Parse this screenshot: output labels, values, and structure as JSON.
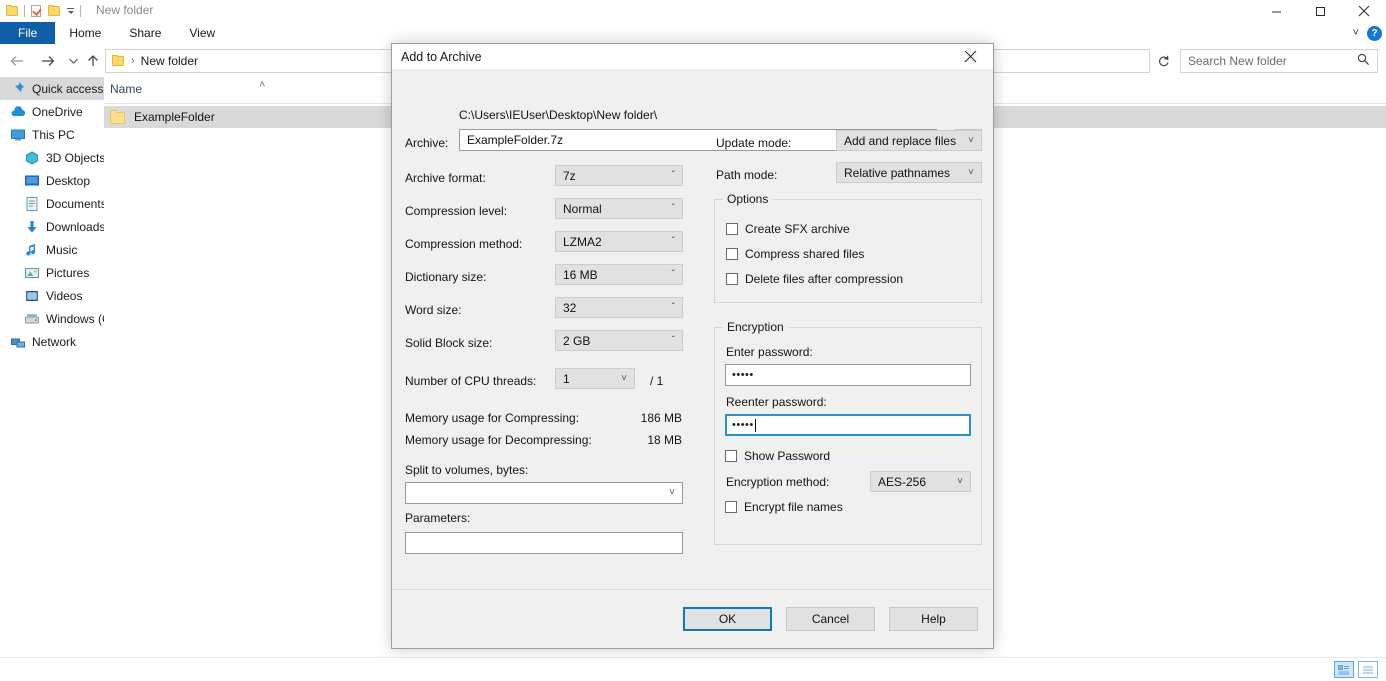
{
  "explorer": {
    "window_title": "New folder",
    "quick_access_toolbar": [
      "folder-icon",
      "properties-icon",
      "new-folder-icon",
      "customize-caret-icon"
    ],
    "ribbon_tabs": [
      {
        "label": "File",
        "active": true
      },
      {
        "label": "Home",
        "active": false
      },
      {
        "label": "Share",
        "active": false
      },
      {
        "label": "View",
        "active": false
      }
    ],
    "window_controls": {
      "minimize": "minimize-icon",
      "maximize": "maximize-icon",
      "close": "close-icon"
    },
    "ribbon_help": "?",
    "breadcrumb": {
      "root_icon": "folder-icon",
      "separator": "›",
      "path": "New folder"
    },
    "search": {
      "placeholder": "Search New folder",
      "value": ""
    },
    "sidebar": [
      {
        "label": "Quick access",
        "icon": "pin-icon",
        "selected": true,
        "indent": false
      },
      {
        "label": "OneDrive",
        "icon": "cloud-icon",
        "selected": false,
        "indent": false
      },
      {
        "label": "This PC",
        "icon": "monitor-icon",
        "selected": false,
        "indent": false
      },
      {
        "label": "3D Objects",
        "icon": "cube-icon",
        "selected": false,
        "indent": true
      },
      {
        "label": "Desktop",
        "icon": "desktop-icon",
        "selected": false,
        "indent": true
      },
      {
        "label": "Documents",
        "icon": "document-icon",
        "selected": false,
        "indent": true
      },
      {
        "label": "Downloads",
        "icon": "download-icon",
        "selected": false,
        "indent": true
      },
      {
        "label": "Music",
        "icon": "music-note-icon",
        "selected": false,
        "indent": true
      },
      {
        "label": "Pictures",
        "icon": "picture-icon",
        "selected": false,
        "indent": true
      },
      {
        "label": "Videos",
        "icon": "video-icon",
        "selected": false,
        "indent": true
      },
      {
        "label": "Windows (C:)",
        "icon": "drive-icon",
        "selected": false,
        "indent": true
      },
      {
        "label": "Network",
        "icon": "network-icon",
        "selected": false,
        "indent": false
      }
    ],
    "list": {
      "column_header": "Name",
      "sort_caret": "˄",
      "rows": [
        {
          "name": "ExampleFolder",
          "icon": "folder-icon",
          "selected": true
        }
      ]
    },
    "statusbar": {
      "text": "",
      "view_buttons": [
        "details-view-icon",
        "large-icons-view-icon"
      ]
    }
  },
  "dialog": {
    "title": "Add to Archive",
    "close_icon": "close-icon",
    "archive": {
      "label": "Archive:",
      "path": "C:\\Users\\IEUser\\Desktop\\New folder\\",
      "value": "ExampleFolder.7z",
      "browse_label": "..."
    },
    "left_fields": [
      {
        "label": "Archive format:",
        "value": "7z"
      },
      {
        "label": "Compression level:",
        "value": "Normal"
      },
      {
        "label": "Compression method:",
        "value": "LZMA2"
      },
      {
        "label": "Dictionary size:",
        "value": "16 MB"
      },
      {
        "label": "Word size:",
        "value": "32"
      },
      {
        "label": "Solid Block size:",
        "value": "2 GB"
      }
    ],
    "cpu_threads": {
      "label": "Number of CPU threads:",
      "value": "1",
      "total": "/ 1"
    },
    "memory": [
      {
        "label": "Memory usage for Compressing:",
        "value": "186 MB"
      },
      {
        "label": "Memory usage for Decompressing:",
        "value": "18 MB"
      }
    ],
    "split_volumes": {
      "label": "Split to volumes, bytes:",
      "value": ""
    },
    "parameters": {
      "label": "Parameters:",
      "value": ""
    },
    "right_fields": [
      {
        "label": "Update mode:",
        "value": "Add and replace files"
      },
      {
        "label": "Path mode:",
        "value": "Relative pathnames"
      }
    ],
    "options": {
      "legend": "Options",
      "items": [
        {
          "label": "Create SFX archive",
          "checked": false
        },
        {
          "label": "Compress shared files",
          "checked": false
        },
        {
          "label": "Delete files after compression",
          "checked": false
        }
      ]
    },
    "encryption": {
      "legend": "Encryption",
      "enter_password": {
        "label": "Enter password:",
        "value": "•••••",
        "focused": false
      },
      "reenter_password": {
        "label": "Reenter password:",
        "value": "•••••",
        "focused": true
      },
      "show_password": {
        "label": "Show Password",
        "checked": false
      },
      "method": {
        "label": "Encryption method:",
        "value": "AES-256"
      },
      "encrypt_file_names": {
        "label": "Encrypt file names",
        "checked": false
      }
    },
    "buttons": [
      {
        "label": "OK",
        "default": true
      },
      {
        "label": "Cancel",
        "default": false
      },
      {
        "label": "Help",
        "default": false
      }
    ],
    "accent_color": "#0e7ac4",
    "focus_color": "#2a8fd4"
  }
}
